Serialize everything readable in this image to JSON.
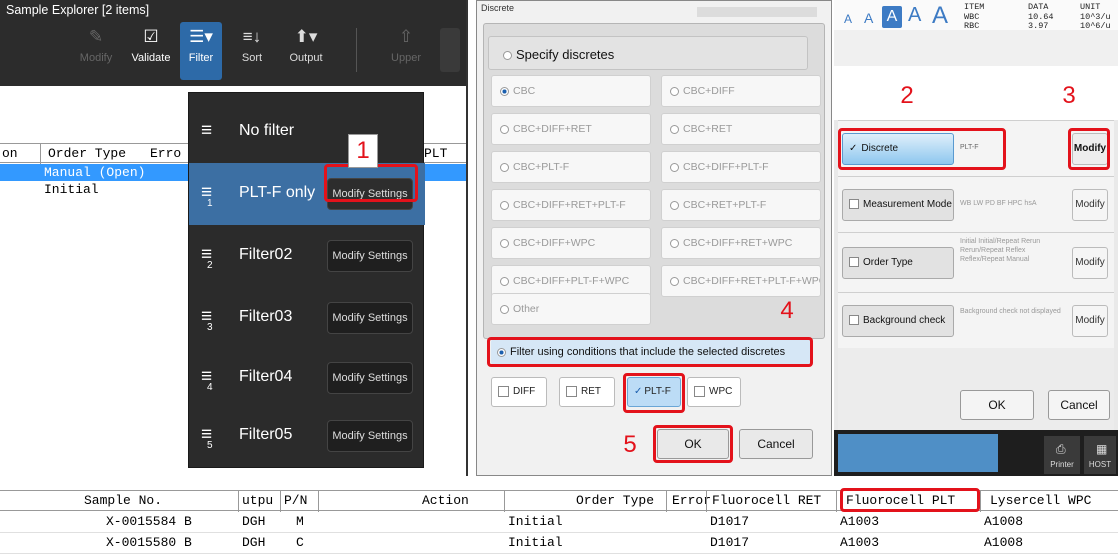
{
  "explorer": {
    "title": "Sample Explorer [2 items]",
    "toolbar": [
      {
        "label": "Modify",
        "icon": "modify-icon"
      },
      {
        "label": "Validate",
        "icon": "checkbox-icon"
      },
      {
        "label": "Filter",
        "icon": "filter-icon"
      },
      {
        "label": "Sort",
        "icon": "sort-icon"
      },
      {
        "label": "Output",
        "icon": "output-icon"
      },
      {
        "label": "Upper",
        "icon": "arrow-up-icon"
      }
    ],
    "columns": [
      "on",
      "Order Type",
      "Erro",
      "PLT"
    ],
    "rows": [
      "Manual (Open)",
      "Initial"
    ],
    "filter_menu": {
      "items": [
        {
          "label": "No filter",
          "button": ""
        },
        {
          "label": "PLT-F only",
          "button": "Modify Settings"
        },
        {
          "label": "Filter02",
          "button": "Modify Settings"
        },
        {
          "label": "Filter03",
          "button": "Modify Settings"
        },
        {
          "label": "Filter04",
          "button": "Modify Settings"
        },
        {
          "label": "Filter05",
          "button": "Modify Settings"
        }
      ],
      "subscripts": [
        "",
        "1",
        "2",
        "3",
        "4",
        "5"
      ]
    }
  },
  "callouts": [
    "1",
    "2",
    "3",
    "4",
    "5"
  ],
  "discrete_dialog": {
    "title": "Discrete",
    "specify_label": "Specify discretes",
    "options": [
      "CBC",
      "CBC+DIFF",
      "CBC+DIFF+RET",
      "CBC+RET",
      "CBC+PLT-F",
      "CBC+DIFF+PLT-F",
      "CBC+DIFF+RET+PLT-F",
      "CBC+RET+PLT-F",
      "CBC+DIFF+WPC",
      "CBC+DIFF+RET+WPC",
      "CBC+DIFF+PLT-F+WPC",
      "CBC+DIFF+RET+PLT-F+WPC",
      "Other"
    ],
    "filter_label": "Filter using conditions that include the selected discretes",
    "checks": [
      {
        "label": "DIFF",
        "checked": false
      },
      {
        "label": "RET",
        "checked": false
      },
      {
        "label": "PLT-F",
        "checked": true
      },
      {
        "label": "WPC",
        "checked": false
      }
    ],
    "ok_label": "OK",
    "cancel_label": "Cancel"
  },
  "settings": {
    "font_sizes": [
      "A",
      "A",
      "A",
      "A",
      "A"
    ],
    "mini_table": {
      "headers": [
        "ITEM",
        "DATA",
        "UNIT"
      ],
      "rows": [
        [
          "WBC",
          "10.64",
          "10^3/u"
        ],
        [
          "RBC",
          "3.97",
          "10^6/u"
        ]
      ]
    },
    "rows": [
      {
        "label": "Discrete",
        "desc": "PLT-F",
        "checked": true,
        "modify": "Modify"
      },
      {
        "label": "Measurement Mode",
        "desc": "WB LW PD BF HPC hsA",
        "checked": false,
        "modify": "Modify"
      },
      {
        "label": "Order Type",
        "desc": "Initial Initial/Repeat Rerun Rerun/Repeat Reflex Reflex/Repeat Manual",
        "checked": false,
        "modify": "Modify"
      },
      {
        "label": "Background check",
        "desc": "Background check not displayed",
        "checked": false,
        "modify": "Modify"
      }
    ],
    "ok_label": "OK",
    "cancel_label": "Cancel",
    "printer_label": "Printer",
    "host_label": "HOST"
  },
  "bottom_table": {
    "headers": [
      "Sample No.",
      "utpu",
      "P/N",
      "Action",
      "Order Type",
      "Error",
      "Fluorocell RET",
      "Fluorocell PLT",
      "Lysercell WPC"
    ],
    "rows": [
      [
        "X-0015584 B",
        "DGH",
        "M",
        "",
        "Initial",
        "",
        "D1017",
        "A1003",
        "A1008"
      ],
      [
        "X-0015580 B",
        "DGH",
        "C",
        "",
        "Initial",
        "",
        "D1017",
        "A1003",
        "A1008"
      ]
    ]
  },
  "colors": {
    "accent": "#2d6aa8",
    "highlight": "#e3121b",
    "selection": "#3399ff"
  }
}
